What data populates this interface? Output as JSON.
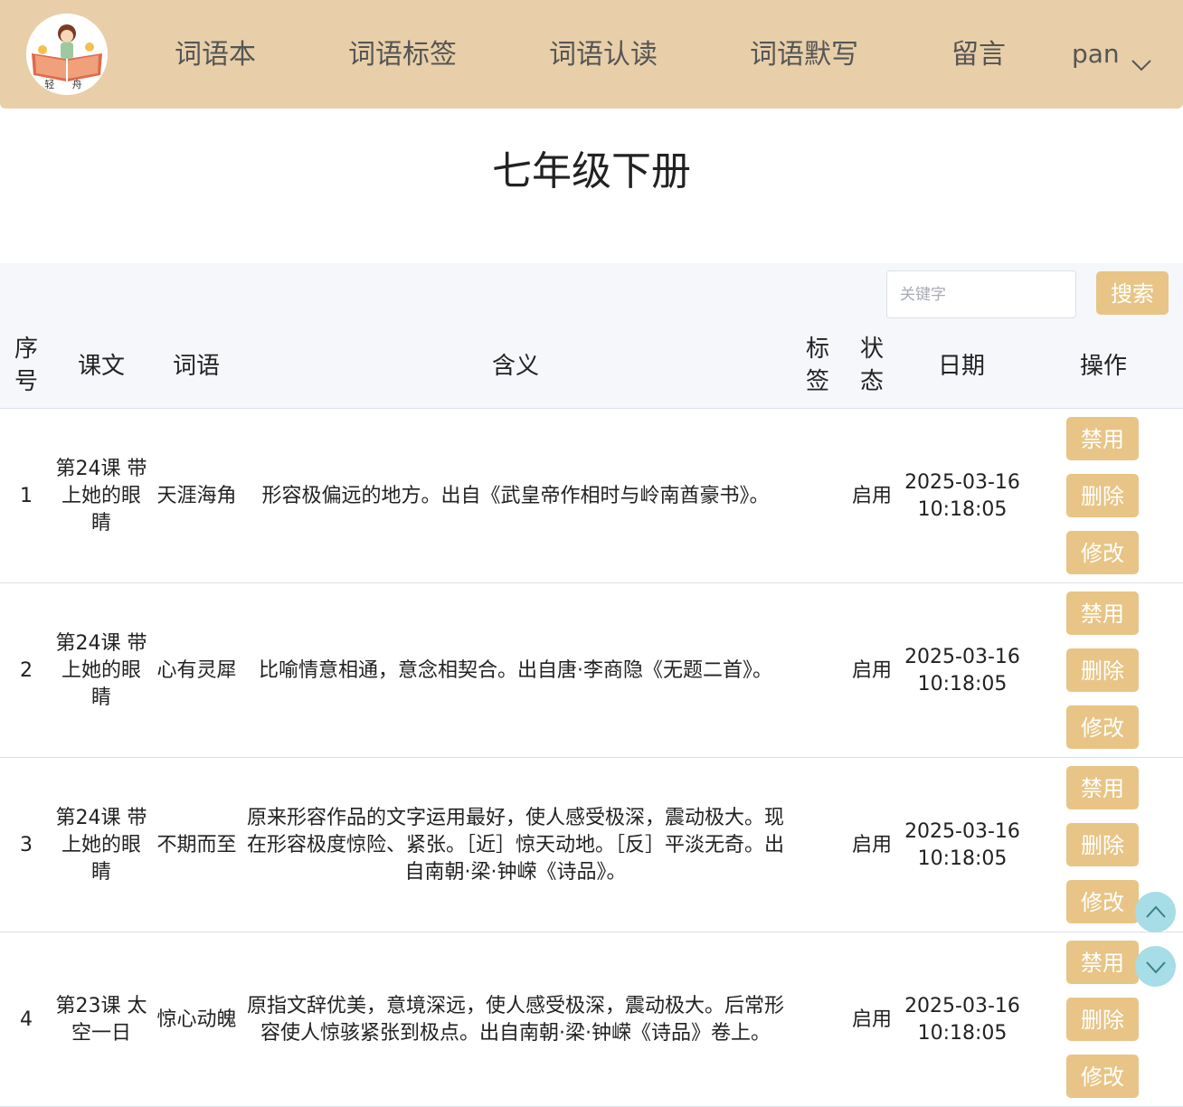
{
  "logo": {
    "text": "轻 舟"
  },
  "nav": {
    "items": [
      "词语本",
      "词语标签",
      "词语认读",
      "词语默写",
      "留言"
    ],
    "user": "pan"
  },
  "page": {
    "title": "七年级下册"
  },
  "search": {
    "placeholder": "关键字",
    "button": "搜索"
  },
  "table": {
    "headers": {
      "index": "序号",
      "lesson": "课文",
      "word": "词语",
      "meaning": "含义",
      "tag": "标签",
      "status": "状态",
      "date": "日期",
      "ops": "操作"
    },
    "rows": [
      {
        "index": "1",
        "lesson": "第24课 带上她的眼睛",
        "word": "天涯海角",
        "meaning": "形容极偏远的地方。出自《武皇帝作相时与岭南酋豪书》。",
        "tag": "",
        "status": "启用",
        "date": "2025-03-16 10:18:05"
      },
      {
        "index": "2",
        "lesson": "第24课 带上她的眼睛",
        "word": "心有灵犀",
        "meaning": "比喻情意相通，意念相契合。出自唐·李商隐《无题二首》。",
        "tag": "",
        "status": "启用",
        "date": "2025-03-16 10:18:05"
      },
      {
        "index": "3",
        "lesson": "第24课 带上她的眼睛",
        "word": "不期而至",
        "meaning": "原来形容作品的文字运用最好，使人感受极深，震动极大。现在形容极度惊险、紧张。［近］惊天动地。［反］平淡无奇。出自南朝·梁·钟嵘《诗品》。",
        "tag": "",
        "status": "启用",
        "date": "2025-03-16 10:18:05"
      },
      {
        "index": "4",
        "lesson": "第23课 太空一日",
        "word": "惊心动魄",
        "meaning": "原指文辞优美，意境深远，使人感受极深，震动极大。后常形容使人惊骇紧张到极点。出自南朝·梁·钟嵘《诗品》卷上。",
        "tag": "",
        "status": "启用",
        "date": "2025-03-16 10:18:05"
      }
    ],
    "ops": {
      "disable": "禁用",
      "delete": "删除",
      "edit": "修改"
    }
  },
  "colors": {
    "navbar": "#e8cfa9",
    "button": "#e8c586",
    "floatButton": "#a6dde6",
    "headerBg": "#f5f7fa"
  },
  "icons": {
    "userMenu": "chevron-down-icon",
    "scrollUp": "chevron-up-icon",
    "scrollDown": "chevron-down-icon"
  }
}
